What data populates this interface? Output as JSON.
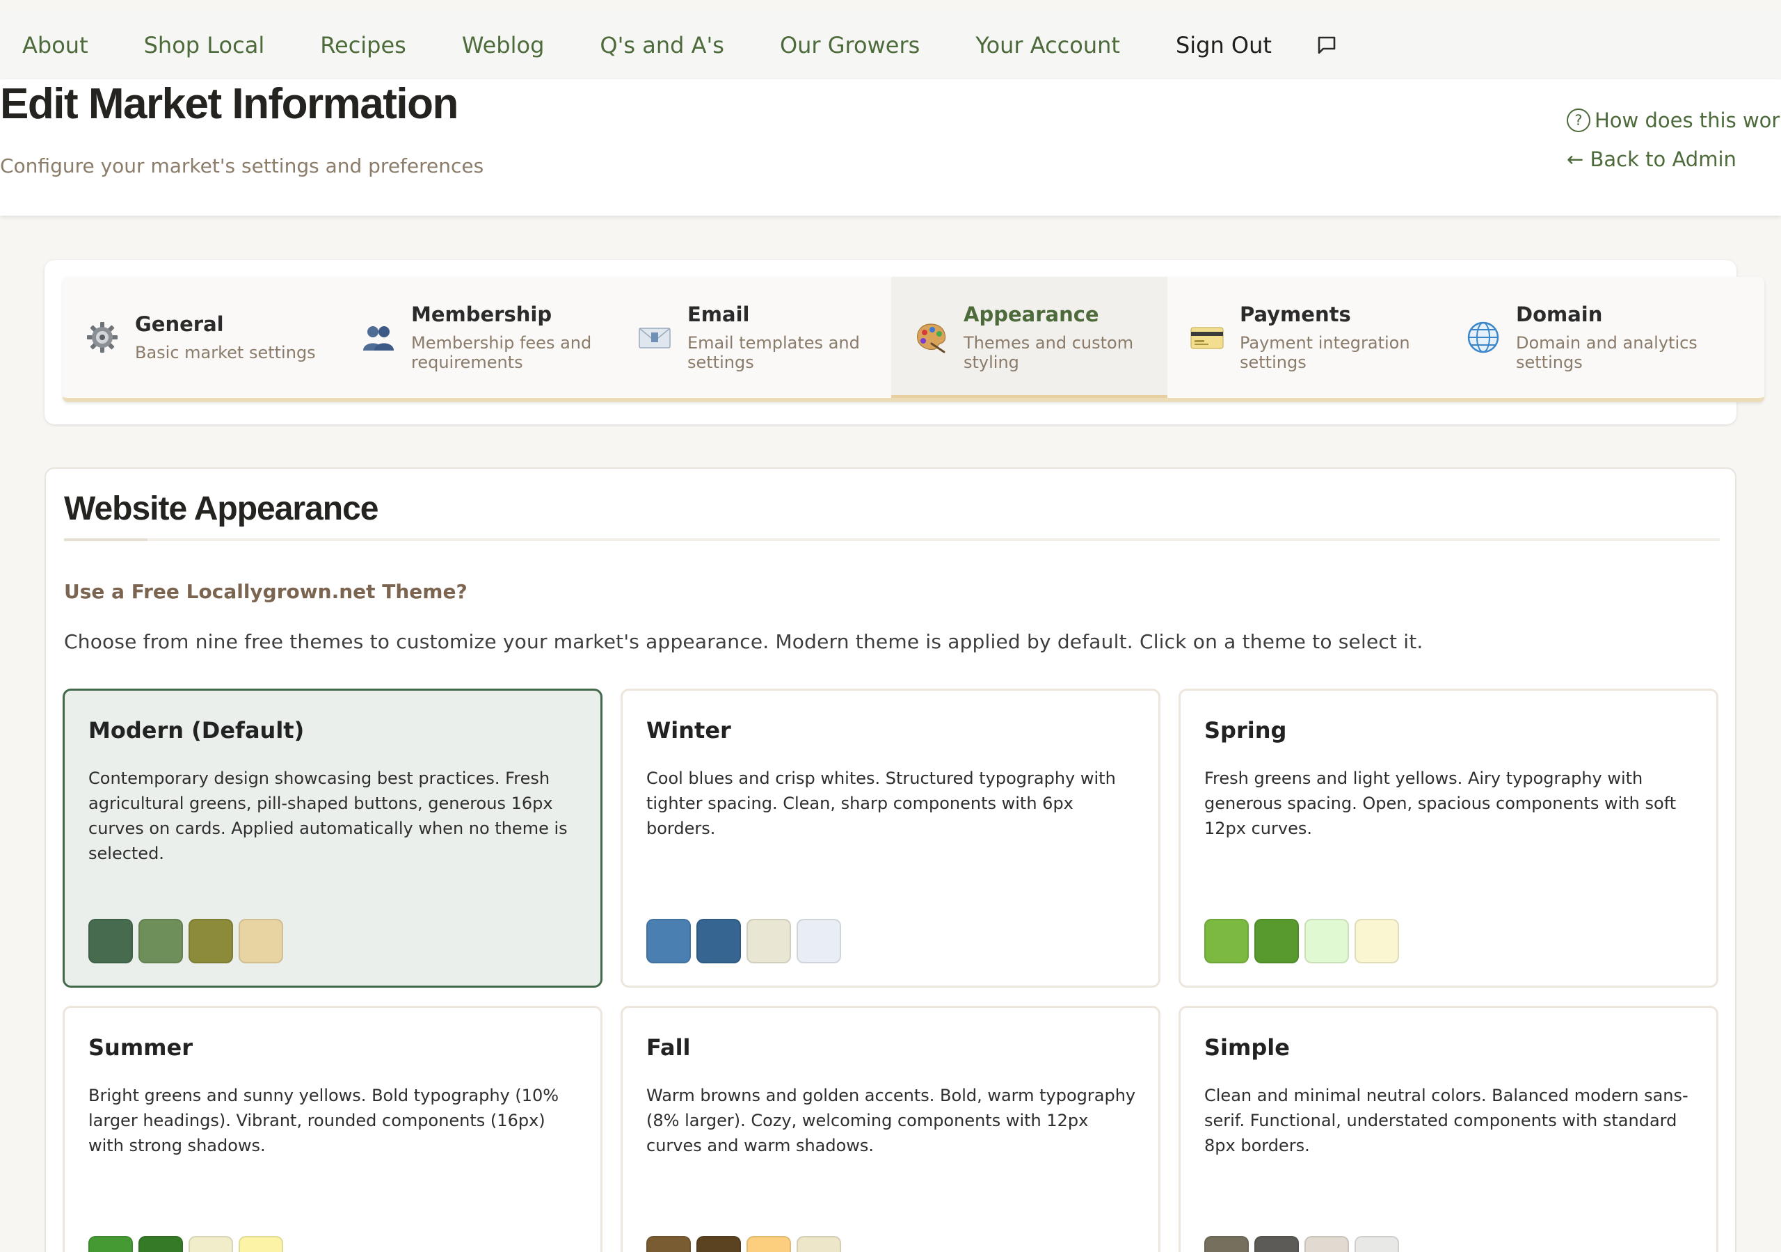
{
  "nav": {
    "items": [
      "About",
      "Shop Local",
      "Recipes",
      "Weblog",
      "Q's and A's",
      "Our Growers",
      "Your Account"
    ],
    "sign_out": "Sign Out",
    "chat_icon": "chat-bubble-icon"
  },
  "header": {
    "title": "Edit Market Information",
    "subtitle": "Configure your market's settings and preferences",
    "help_link": "How does this work?",
    "back_link": "← Back to Admin"
  },
  "tabs": [
    {
      "title": "General",
      "desc": "Basic market settings",
      "icon": "gear-icon"
    },
    {
      "title": "Membership",
      "desc": "Membership fees and requirements",
      "icon": "people-icon"
    },
    {
      "title": "Email",
      "desc": "Email templates and settings",
      "icon": "envelope-icon"
    },
    {
      "title": "Appearance",
      "desc": "Themes and custom styling",
      "icon": "palette-icon",
      "active": true
    },
    {
      "title": "Payments",
      "desc": "Payment integration settings",
      "icon": "credit-card-icon"
    },
    {
      "title": "Domain",
      "desc": "Domain and analytics settings",
      "icon": "globe-icon"
    }
  ],
  "appearance": {
    "title": "Website Appearance",
    "subheading": "Use a Free Locallygrown.net Theme?",
    "intro": "Choose from nine free themes to customize your market's appearance. Modern theme is applied by default. Click on a theme to select it.",
    "themes": [
      {
        "name": "Modern (Default)",
        "desc": "Contemporary design showcasing best practices. Fresh agricultural greens, pill-shaped buttons, generous 16px curves on cards. Applied automatically when no theme is selected.",
        "colors": [
          "#476b4f",
          "#6f8f5a",
          "#8b8b3a",
          "#e8d3a2"
        ],
        "selected": true
      },
      {
        "name": "Winter",
        "desc": "Cool blues and crisp whites. Structured typography with tighter spacing. Clean, sharp components with 6px borders.",
        "colors": [
          "#4a7fb2",
          "#356590",
          "#eae6d4",
          "#e8eef4"
        ]
      },
      {
        "name": "Spring",
        "desc": "Fresh greens and light yellows. Airy typography with generous spacing. Open, spacious components with soft 12px curves.",
        "colors": [
          "#7cb940",
          "#599a2e",
          "#e1f9d2",
          "#faf6d1"
        ]
      },
      {
        "name": "Summer",
        "desc": "Bright greens and sunny yellows. Bold typography (10% larger headings). Vibrant, rounded components (16px) with strong shadows.",
        "colors": [
          "#459a34",
          "#357a27",
          "#f1edcb",
          "#fdf3a6"
        ]
      },
      {
        "name": "Fall",
        "desc": "Warm browns and golden accents. Bold, warm typography (8% larger). Cozy, welcoming components with 12px curves and warm shadows.",
        "colors": [
          "#7a5c32",
          "#5b4322",
          "#fbcf7e",
          "#ede6c9"
        ]
      },
      {
        "name": "Simple",
        "desc": "Clean and minimal neutral colors. Balanced modern sans-serif. Functional, understated components with standard 8px borders.",
        "colors": [
          "#75705e",
          "#5c5b57",
          "#e0dad0",
          "#e8e9e6"
        ]
      }
    ]
  }
}
